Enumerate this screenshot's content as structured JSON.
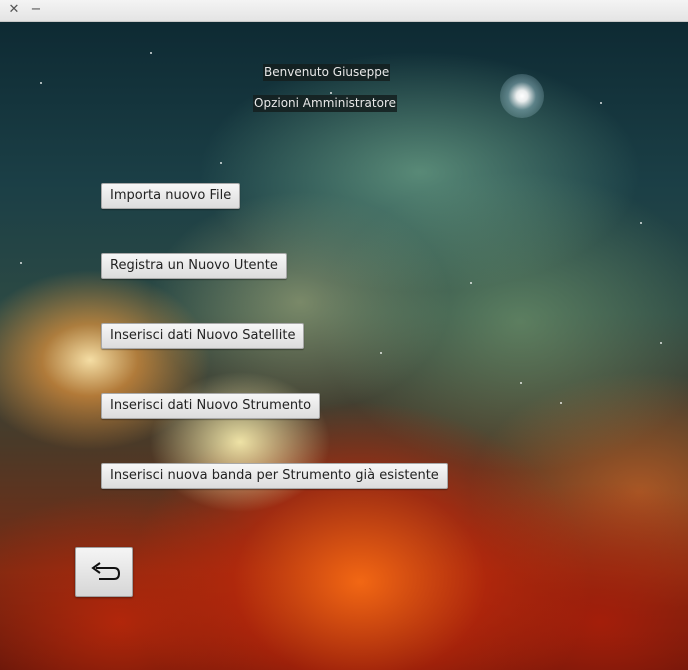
{
  "window": {
    "close_glyph": "✕",
    "minimize_glyph": "−"
  },
  "header": {
    "welcome": "Benvenuto Giuseppe",
    "subtitle": "Opzioni Amministratore"
  },
  "menu": {
    "import_file": "Importa nuovo File",
    "register_user": "Registra un Nuovo Utente",
    "insert_satellite": "Inserisci dati Nuovo Satellite",
    "insert_instrument": "Inserisci dati Nuovo Strumento",
    "insert_band": "Inserisci nuova banda per Strumento già esistente"
  },
  "back_button": {
    "icon": "return-arrow-icon"
  }
}
